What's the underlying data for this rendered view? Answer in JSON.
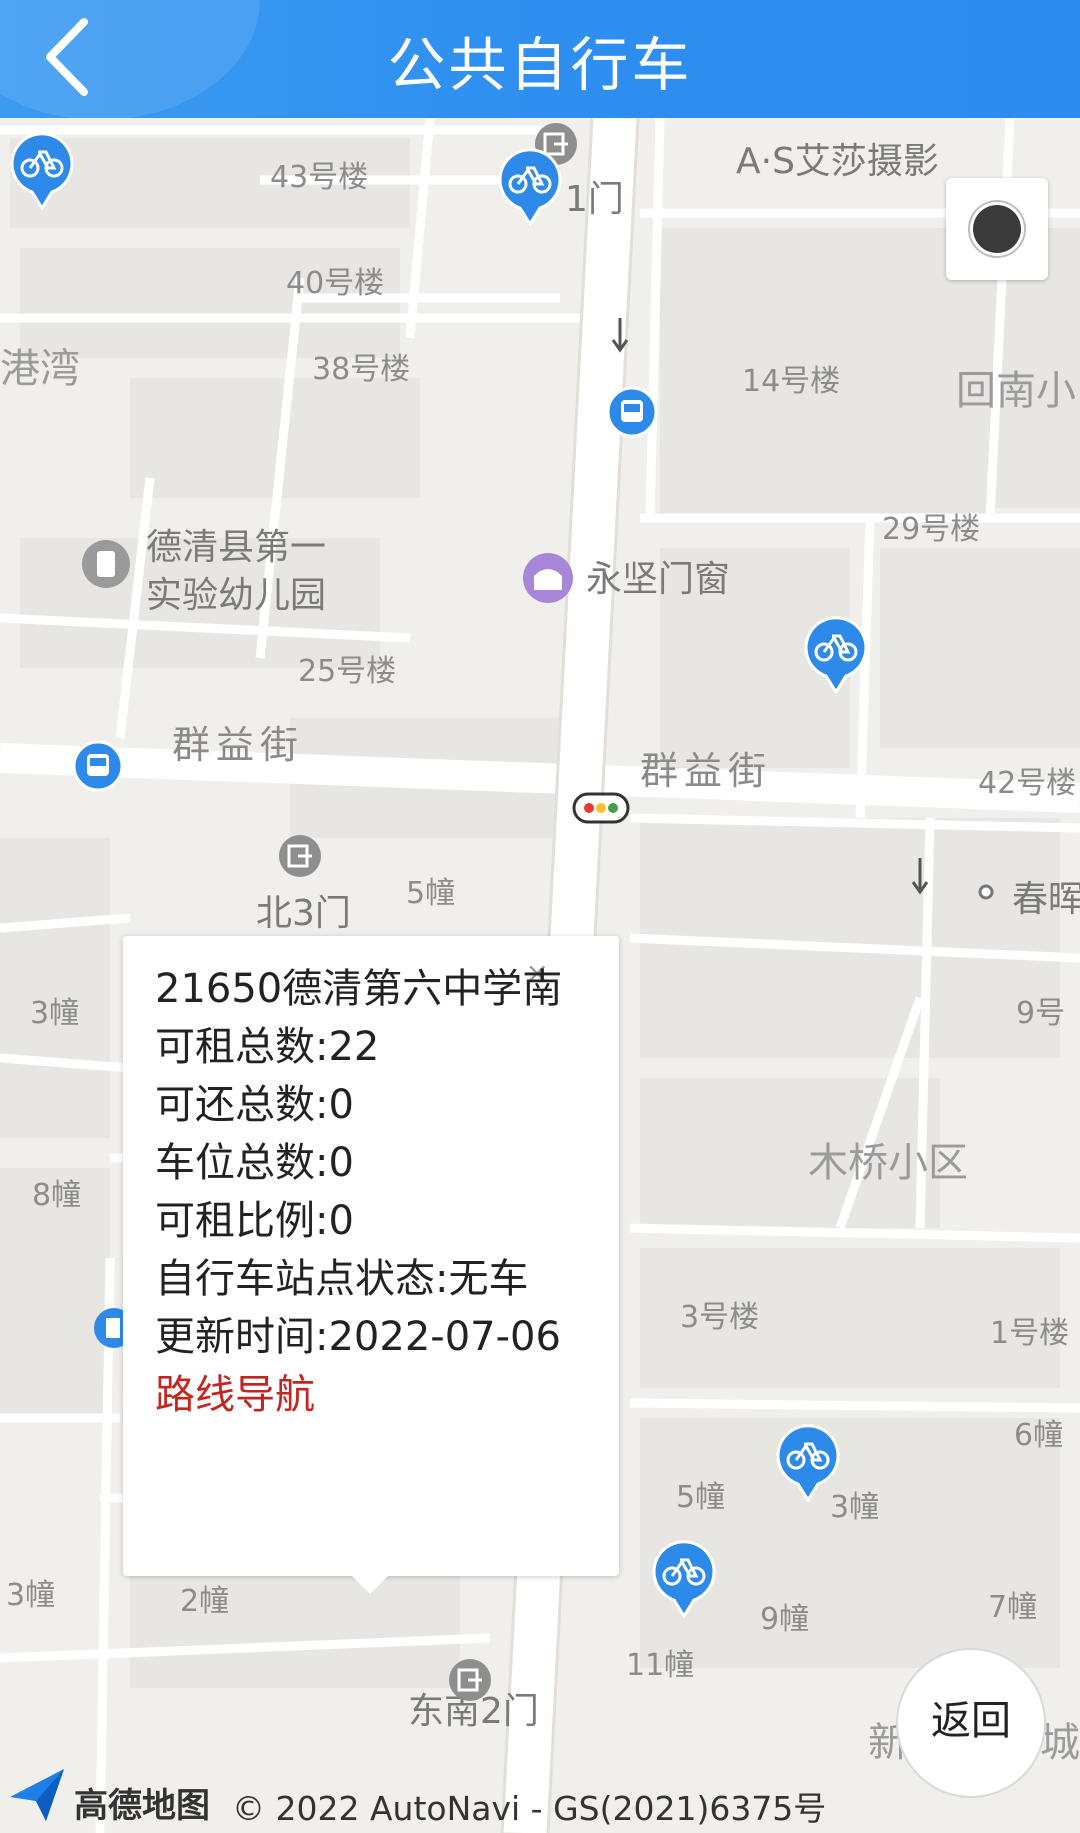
{
  "header": {
    "title": "公共自行车"
  },
  "map": {
    "labels": {
      "l1": "43号楼",
      "l2": "1门",
      "l3": "A·S艾莎摄影",
      "l4": "40号楼",
      "l5": "港湾",
      "l6": "38号楼",
      "l7": "14号楼",
      "l8": "回南小",
      "l9": "德清县第一",
      "l10": "实验幼儿园",
      "l11": "永坚门窗",
      "l12": "29号楼",
      "l13": "25号楼",
      "l14": "群益街",
      "l15": "群益街",
      "l16": "42号楼",
      "l17": "北3门",
      "l18": "5幢",
      "l19": "春晖",
      "l20": "3幢",
      "l21": "9号",
      "l22": "木桥小区",
      "l23": "8幢",
      "l24": "3号楼",
      "l25": "1号楼",
      "l26": "6幢",
      "l27": "5幢",
      "l28": "5幢",
      "l29": "3幢",
      "l30": "3幢",
      "l31": "2幢",
      "l32": "9幢",
      "l33": "7幢",
      "l34": "11幢",
      "l35": "东南2门",
      "l36": "新",
      "l37": "城"
    }
  },
  "popup": {
    "station": "21650德清第六中学南",
    "rentable": "可租总数:22",
    "returnable": "可还总数:0",
    "slots": "车位总数:0",
    "ratio": "可租比例:0",
    "status": "自行车站点状态:无车",
    "updated": "更新时间:2022-07-06",
    "navigate": "路线导航",
    "close": "×"
  },
  "buttons": {
    "return_label": "返回"
  },
  "footer": {
    "logo_text": "高德地图",
    "copyright": "© 2022 AutoNavi - GS(2021)6375号"
  },
  "icons": {
    "back": "chevron-left-icon",
    "bike": "bicycle-icon",
    "bus": "bus-icon",
    "exit": "exit-icon",
    "traffic": "traffic-light-icon",
    "locate": "locate-icon"
  },
  "colors": {
    "header": "#2f8ff0",
    "marker": "#2e8ae8",
    "nav_link": "#c2261f",
    "map_bg": "#f1efec",
    "road": "#ffffff"
  }
}
